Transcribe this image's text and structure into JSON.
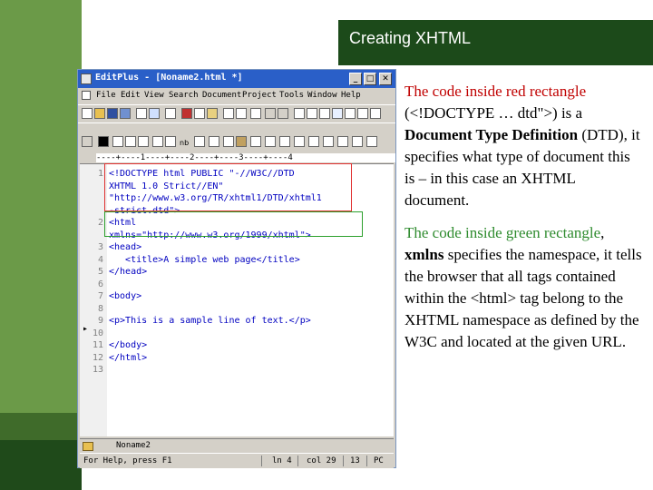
{
  "slide": {
    "title": "Creating XHTML"
  },
  "window": {
    "title": "EditPlus - [Noname2.html *]",
    "menu": [
      "File",
      "Edit",
      "View",
      "Search",
      "Document",
      "Project",
      "Tools",
      "Window",
      "Help"
    ]
  },
  "toolbar2": {
    "label_nb": "nb"
  },
  "ruler": "----+----1----+----2----+----3----+----4",
  "code": [
    {
      "n": "1",
      "t": "<!DOCTYPE html PUBLIC \"-//W3C//DTD"
    },
    {
      "n": "",
      "t": "XHTML 1.0 Strict//EN\""
    },
    {
      "n": "",
      "t": "\"http://www.w3.org/TR/xhtml1/DTD/xhtml1"
    },
    {
      "n": "",
      "t": "-strict.dtd\">"
    },
    {
      "n": "2",
      "t": "<html"
    },
    {
      "n": "",
      "t": "xmlns=\"http://www.w3.org/1999/xhtml\">"
    },
    {
      "n": "3",
      "t": "<head>"
    },
    {
      "n": "4",
      "t": "   <title>A simple web page</title>"
    },
    {
      "n": "5",
      "t": "</head>"
    },
    {
      "n": "6",
      "t": ""
    },
    {
      "n": "7",
      "t": "<body>"
    },
    {
      "n": "8",
      "t": ""
    },
    {
      "n": "9",
      "t": "<p>This is a sample line of text.</p>"
    },
    {
      "n": "10",
      "t": ""
    },
    {
      "n": "11",
      "t": "</body>"
    },
    {
      "n": "12",
      "t": "</html>"
    },
    {
      "n": "13",
      "t": ""
    }
  ],
  "tabbar": {
    "tab": "Noname2"
  },
  "status": {
    "help": "For Help, press F1",
    "ln": "ln 4",
    "col": "col 29",
    "count": "13",
    "pc": "PC"
  },
  "text": {
    "p1_red": "The code inside red rectangle",
    "p1_rest": "(<!DOCTYPE … dtd\">) is a",
    "p1_bold": "Document Type Definition",
    "p1_end": "(DTD), it specifies what type of document this is – in this case an XHTML document.",
    "p2_green": "The code inside green rectangle",
    "p2_comma": ",",
    "p2_bold": "xmlns",
    "p2_end": "specifies the namespace, it tells the browser that all tags contained within the <html> tag belong to the XHTML namespace as defined by the W3C and located at the given URL."
  },
  "colors": {
    "accent_green": "#6b9a48",
    "dark_green": "#1c4a1a",
    "red": "#c00000",
    "green": "#2e8b2e"
  }
}
